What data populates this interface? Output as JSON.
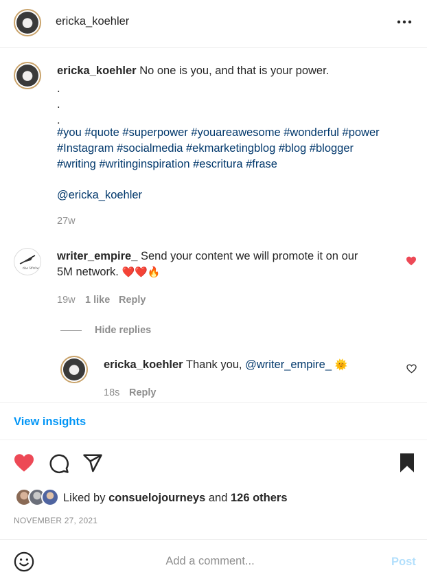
{
  "header": {
    "username": "ericka_koehler",
    "more_icon": "more-horizontal-icon"
  },
  "caption": {
    "username": "ericka_koehler",
    "text": "No one is you, and that is your power.",
    "dots": [
      ".",
      ".",
      "."
    ],
    "hashtag_lines": [
      "#you #quote #superpower #youareawesome #wonderful #power",
      "#Instagram #socialmedia #ekmarketingblog #blog #blogger",
      "#writing #writinginspiration #escritura #frase"
    ],
    "mention": "@ericka_koehler",
    "time": "27w"
  },
  "comment": {
    "username": "writer_empire_",
    "text_line1": "Send your content we will promote it on our",
    "text_line2": "5M network.",
    "emojis": "❤️❤️🔥",
    "time": "19w",
    "likes": "1 like",
    "reply_label": "Reply",
    "hide_replies_label": "Hide replies",
    "liked": true
  },
  "reply": {
    "username": "ericka_koehler",
    "text": "Thank you,",
    "mention": "@writer_empire_",
    "emoji": "🌞",
    "time": "18s",
    "reply_label": "Reply",
    "liked": false
  },
  "view_insights": "View insights",
  "actions": {
    "like_icon": "heart-filled-icon",
    "comment_icon": "comment-icon",
    "share_icon": "share-icon",
    "save_icon": "bookmark-filled-icon"
  },
  "likes": {
    "prefix": "Liked by",
    "user": "consuelojourneys",
    "and": "and",
    "others": "126 others"
  },
  "date": "NOVEMBER 27, 2021",
  "composer": {
    "placeholder": "Add a comment...",
    "post_label": "Post",
    "emoji_icon": "smiley-icon"
  },
  "colors": {
    "like_red": "#ed4956",
    "link_blue": "#0095f6",
    "hashtag_blue": "#00376b",
    "muted_gray": "#8e8e8e"
  }
}
